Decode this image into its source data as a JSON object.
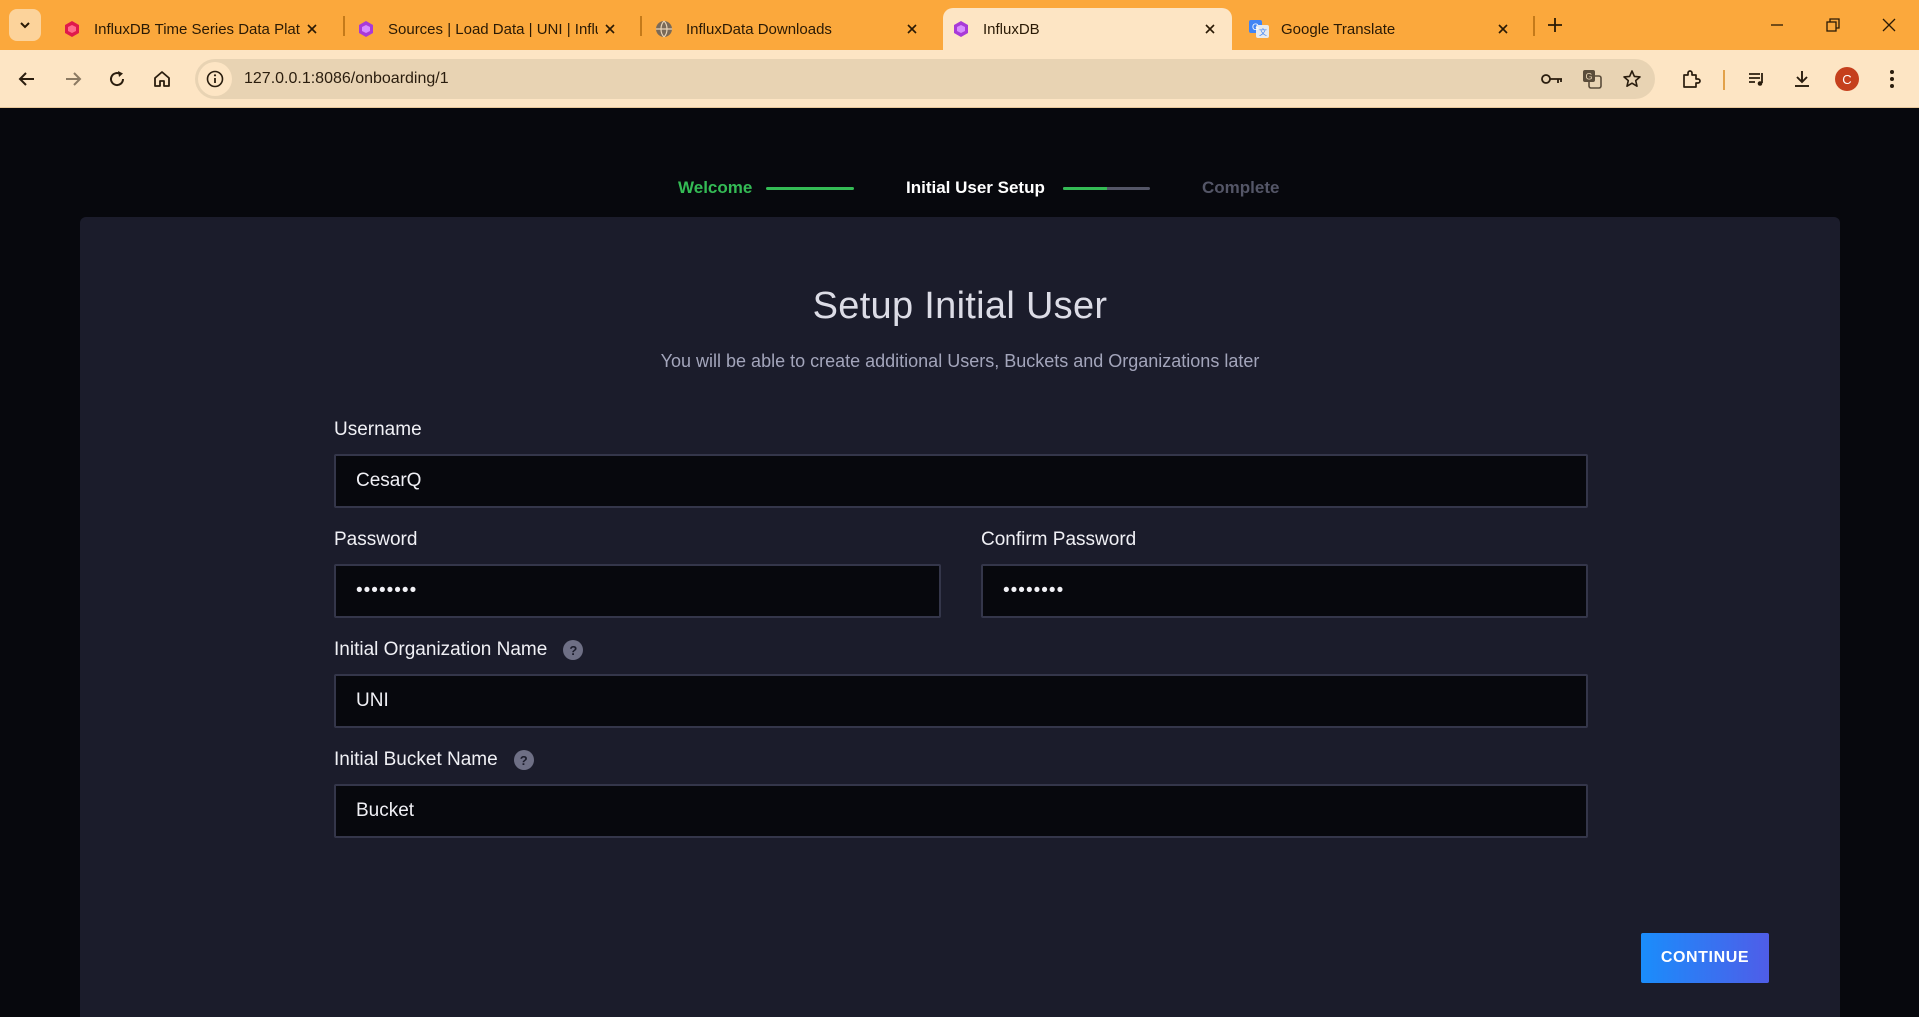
{
  "browser": {
    "tabs": [
      {
        "title": "InfluxDB Time Series Data Platform",
        "icon": "influxdb-red-icon"
      },
      {
        "title": "Sources | Load Data | UNI | InfluxDB",
        "icon": "influxdb-purple-icon"
      },
      {
        "title": "InfluxData Downloads",
        "icon": "globe-icon"
      },
      {
        "title": "InfluxDB",
        "icon": "influxdb-purple-icon",
        "active": true
      },
      {
        "title": "Google Translate",
        "icon": "google-translate-icon"
      }
    ],
    "url": "127.0.0.1:8086/onboarding/1",
    "profile_initial": "C"
  },
  "stepper": {
    "steps": [
      {
        "label": "Welcome",
        "state": "done"
      },
      {
        "label": "Initial User Setup",
        "state": "current"
      },
      {
        "label": "Complete",
        "state": "pending"
      }
    ],
    "current_step_progress": 0.5
  },
  "form": {
    "title": "Setup Initial User",
    "subtitle": "You will be able to create additional Users, Buckets and Organizations later",
    "username": {
      "label": "Username",
      "value": "CesarQ"
    },
    "password": {
      "label": "Password",
      "value": "••••••••"
    },
    "confirm_password": {
      "label": "Confirm Password",
      "value": "••••••••"
    },
    "organization": {
      "label": "Initial Organization Name",
      "value": "UNI"
    },
    "bucket": {
      "label": "Initial Bucket Name",
      "value": "Bucket"
    },
    "help_glyph": "?",
    "continue_label": "CONTINUE"
  },
  "colors": {
    "accent_green": "#34bb55",
    "pending_gray": "#545667",
    "button_start": "#1a8dfb",
    "button_end": "#4f5de8",
    "chrome_orange": "#fba83c"
  }
}
